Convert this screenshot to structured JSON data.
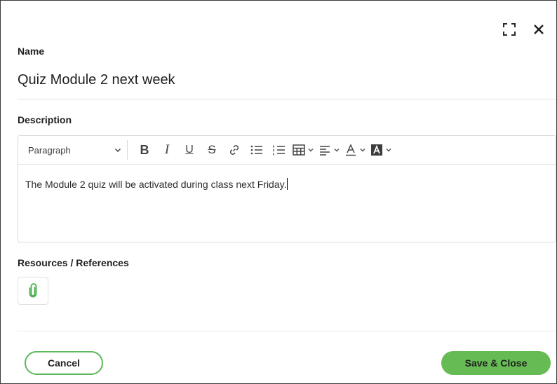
{
  "dialog": {
    "name_label": "Name",
    "name_value": "Quiz Module 2 next week",
    "description_label": "Description",
    "resources_label": "Resources / References"
  },
  "toolbar": {
    "format_value": "Paragraph",
    "bold": "B",
    "italic": "I",
    "underline": "U",
    "strike": "S"
  },
  "editor": {
    "content": "The Module 2 quiz will be activated during class next Friday."
  },
  "footer": {
    "cancel_label": "Cancel",
    "save_label": "Save & Close"
  },
  "colors": {
    "accent": "#66bb55",
    "accent_border": "#5cb85c",
    "attachment_icon": "#4caf50"
  },
  "icons": [
    "expand-icon",
    "close-icon",
    "link-icon",
    "bullet-list-icon",
    "numbered-list-icon",
    "table-icon",
    "align-icon",
    "text-color-icon",
    "highlight-icon",
    "paperclip-icon"
  ]
}
